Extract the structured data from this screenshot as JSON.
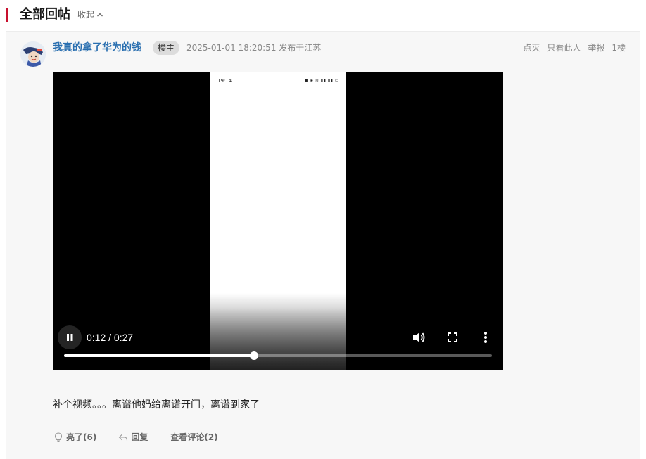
{
  "section": {
    "title": "全部回帖",
    "collapse_label": "收起"
  },
  "post": {
    "username": "我真的拿了华为的钱",
    "op_badge": "楼主",
    "meta": "2025-01-01 18:20:51 发布于江苏",
    "actions": {
      "hide": "点灭",
      "only_this": "只看此人",
      "report": "举报",
      "floor": "1楼"
    },
    "video": {
      "phone_status_time": "19:14",
      "time_display": "0:12 / 0:27",
      "progress": 0.4444
    },
    "text": "补个视频。。。离谱他妈给离谱开门，离谱到家了",
    "footer": {
      "like_label": "亮了(6)",
      "reply_label": "回复",
      "comments_label": "查看评论(2)"
    }
  },
  "colors": {
    "accent_red": "#c8102e",
    "username_blue": "#2a6fb0",
    "card_bg": "#f7f7f7"
  },
  "icons": [
    "chevron-up-icon",
    "pause-icon",
    "volume-icon",
    "fullscreen-icon",
    "more-vert-icon",
    "lightbulb-icon",
    "reply-icon"
  ]
}
